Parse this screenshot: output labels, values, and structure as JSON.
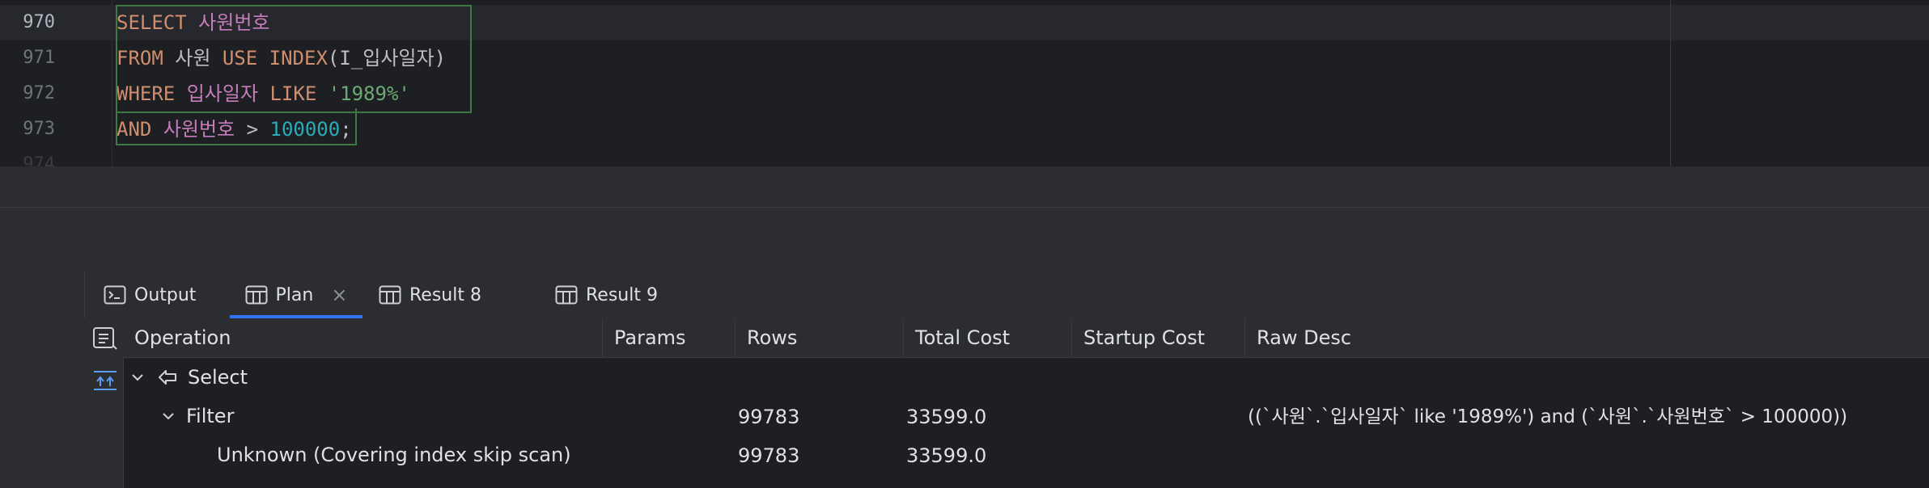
{
  "editor": {
    "lines": [
      {
        "no": "970",
        "parts": [
          {
            "t": "SELECT",
            "c": "kw"
          },
          {
            "t": " "
          },
          {
            "t": "사원번호",
            "c": "ident"
          }
        ]
      },
      {
        "no": "971",
        "parts": [
          {
            "t": "FROM",
            "c": "kw"
          },
          {
            "t": " 사원 "
          },
          {
            "t": "USE INDEX",
            "c": "kw"
          },
          {
            "t": "(I_입사일자)"
          }
        ]
      },
      {
        "no": "972",
        "parts": [
          {
            "t": "WHERE",
            "c": "kw"
          },
          {
            "t": " "
          },
          {
            "t": "입사일자",
            "c": "ident"
          },
          {
            "t": " "
          },
          {
            "t": "LIKE",
            "c": "kw"
          },
          {
            "t": " "
          },
          {
            "t": "'1989%'",
            "c": "str"
          }
        ]
      },
      {
        "no": "973",
        "parts": [
          {
            "t": "AND",
            "c": "kw"
          },
          {
            "t": " "
          },
          {
            "t": "사원번호",
            "c": "ident"
          },
          {
            "t": " > "
          },
          {
            "t": "100000",
            "c": "num"
          },
          {
            "t": ";"
          }
        ]
      },
      {
        "no": "974",
        "parts": []
      }
    ]
  },
  "tabs": {
    "output": "Output",
    "plan": "Plan",
    "plan_close": "×",
    "result8": "Result 8",
    "result9": "Result 9"
  },
  "plan": {
    "columns": [
      "Operation",
      "Params",
      "Rows",
      "Total Cost",
      "Startup Cost",
      "Raw Desc"
    ],
    "rows": [
      {
        "operation": "Select",
        "params": "",
        "rows": "",
        "total_cost": "",
        "startup_cost": "",
        "raw_desc": ""
      },
      {
        "operation": "Filter",
        "params": "",
        "rows": "99783",
        "total_cost": "33599.0",
        "startup_cost": "",
        "raw_desc": "((`사원`.`입사일자` like '1989%') and (`사원`.`사원번호` > 100000))"
      },
      {
        "operation": "Unknown (Covering index skip scan)",
        "params": "",
        "rows": "99783",
        "total_cost": "33599.0",
        "startup_cost": "",
        "raw_desc": ""
      }
    ]
  },
  "colors": {
    "accent": "#3574f0",
    "keyword": "#cf8e6d",
    "identifier": "#c77dbb",
    "string": "#6aab73",
    "number": "#2aacb8"
  }
}
